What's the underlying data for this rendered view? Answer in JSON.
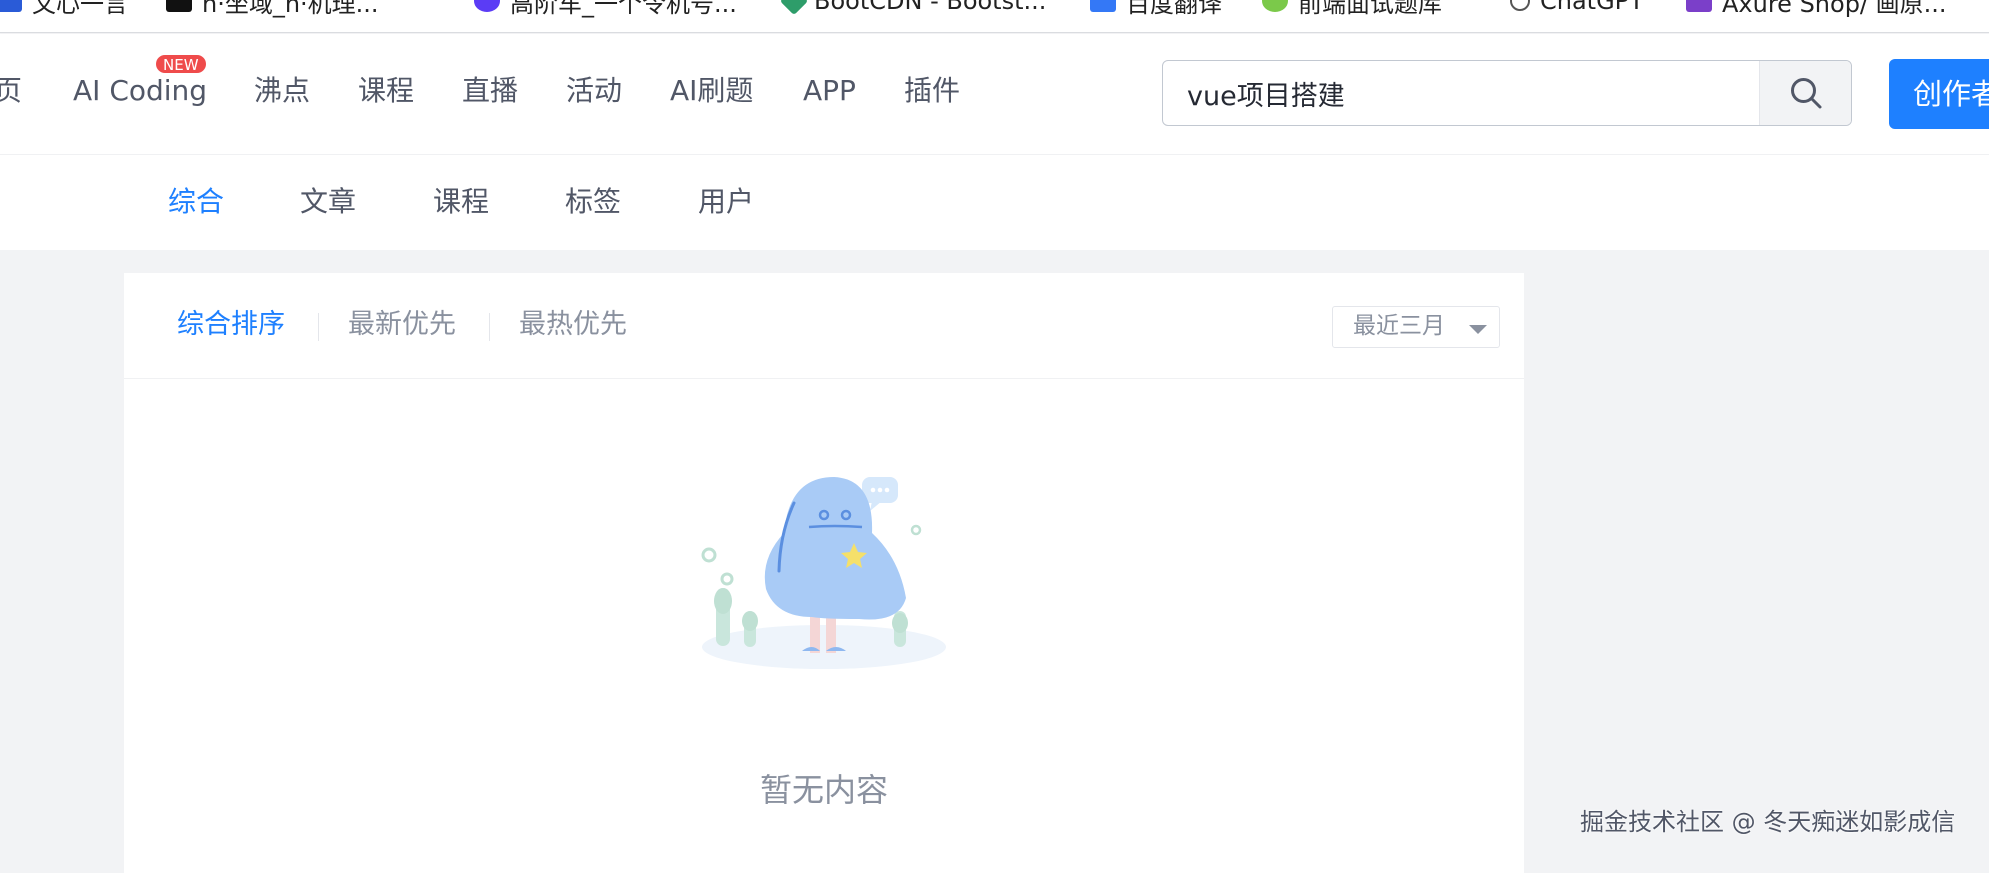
{
  "bookmarks": [
    {
      "label": "文心一言",
      "color": "#2a5bd7"
    },
    {
      "label": "n·坐域_n·机理...",
      "color": "#111111"
    },
    {
      "label": "高阶车_一个令机号...",
      "color": "#5b3cf5"
    },
    {
      "label": "BootCDN - Bootst...",
      "color": "#2e9d6a"
    },
    {
      "label": "百度翻译",
      "color": "#3478f6"
    },
    {
      "label": "前端面试题库",
      "color": "#7bc94a"
    },
    {
      "label": "ChatGPT",
      "color": "#ffffff"
    },
    {
      "label": "Axure Shop/ 画原...",
      "color": "#7b3fc9"
    }
  ],
  "nav": {
    "home": "页",
    "ai_coding": "AI Coding",
    "new_badge": "NEW",
    "pins": "沸点",
    "courses": "课程",
    "live": "直播",
    "events": "活动",
    "ai_quiz": "AI刷题",
    "app": "APP",
    "plugins": "插件"
  },
  "search": {
    "value": "vue项目搭建"
  },
  "create_button": "创作者中心",
  "subtabs": {
    "all": "综合",
    "articles": "文章",
    "courses": "课程",
    "tags": "标签",
    "users": "用户"
  },
  "sort": {
    "overall": "综合排序",
    "newest": "最新优先",
    "hottest": "最热优先",
    "range": "最近三月"
  },
  "empty": {
    "text": "暂无内容"
  },
  "watermark": "掘金技术社区 @ 冬天痴迷如影成信",
  "colors": {
    "accent": "#1e80ff",
    "badge": "#ef4b4b",
    "muted": "#8a919f"
  }
}
